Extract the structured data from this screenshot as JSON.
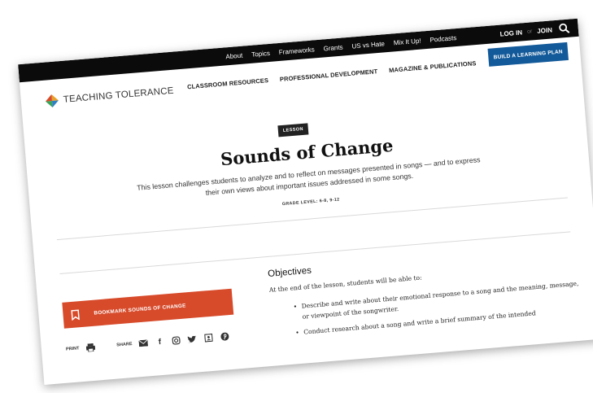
{
  "utility": {
    "links": [
      "About",
      "Topics",
      "Frameworks",
      "Grants",
      "US vs Hate",
      "Mix It Up!",
      "Podcasts"
    ],
    "login": "LOG IN",
    "or": "or",
    "join": "JOIN"
  },
  "brand": {
    "logo_text": "TEACHING TOLERANCE"
  },
  "nav": {
    "items": [
      "CLASSROOM RESOURCES",
      "PROFESSIONAL DEVELOPMENT",
      "MAGAZINE & PUBLICATIONS"
    ],
    "cta": "BUILD A LEARNING PLAN"
  },
  "hero": {
    "badge": "LESSON",
    "title": "Sounds of Change",
    "subtitle": "This lesson challenges students to analyze and to reflect on messages presented in songs — and to express their own views about important issues addressed in some songs.",
    "grade": "GRADE LEVEL: 6-8, 9-12"
  },
  "sidebar": {
    "bookmark_label": "BOOKMARK SOUNDS OF CHANGE",
    "print_label": "PRINT",
    "share_label": "SHARE"
  },
  "objectives": {
    "title": "Objectives",
    "intro": "At the end of the lesson, students will be able to:",
    "items": [
      "Describe and write about their emotional response to a song and the meaning, message, or viewpoint of the songwriter.",
      "Conduct research about a song and write a brief summary of the intended"
    ]
  }
}
